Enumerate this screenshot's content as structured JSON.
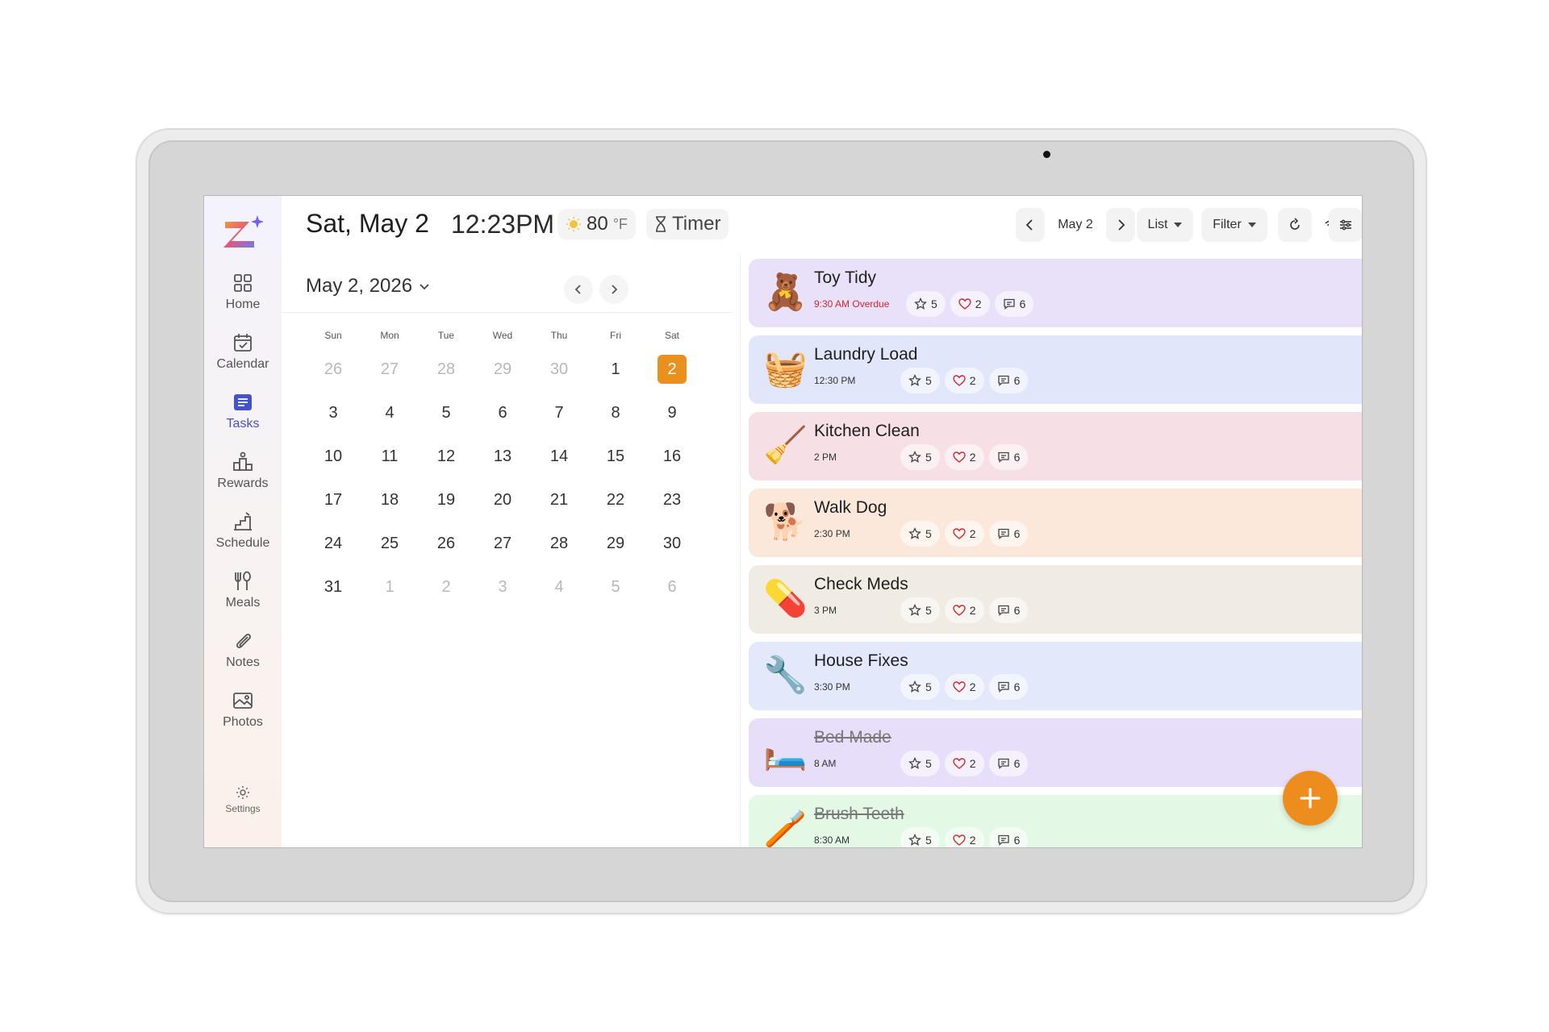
{
  "sidebar": {
    "items": [
      {
        "label": "Home",
        "icon": "home-grid-icon"
      },
      {
        "label": "Calendar",
        "icon": "calendar-check-icon"
      },
      {
        "label": "Tasks",
        "icon": "tasks-list-icon"
      },
      {
        "label": "Rewards",
        "icon": "rewards-podium-icon"
      },
      {
        "label": "Schedule",
        "icon": "schedule-stairs-icon"
      },
      {
        "label": "Meals",
        "icon": "meals-utensils-icon"
      },
      {
        "label": "Notes",
        "icon": "paperclip-icon"
      },
      {
        "label": "Photos",
        "icon": "photo-icon"
      }
    ],
    "active": "Tasks",
    "settings_label": "Settings"
  },
  "header": {
    "date": "Sat, May 2",
    "time": "12:23PM",
    "temperature": "80",
    "temperature_unit": "°F",
    "timer_label": "Timer",
    "current_day": "May 2",
    "view_label": "List",
    "filter_label": "Filter"
  },
  "calendar": {
    "title": "May 2, 2026",
    "weekdays": [
      "Sun",
      "Mon",
      "Tue",
      "Wed",
      "Thu",
      "Fri",
      "Sat"
    ],
    "weeks": [
      [
        "26",
        "27",
        "28",
        "29",
        "30",
        "1",
        "2"
      ],
      [
        "3",
        "4",
        "5",
        "6",
        "7",
        "8",
        "9"
      ],
      [
        "10",
        "11",
        "12",
        "13",
        "14",
        "15",
        "16"
      ],
      [
        "17",
        "18",
        "19",
        "20",
        "21",
        "22",
        "23"
      ],
      [
        "24",
        "25",
        "26",
        "27",
        "28",
        "29",
        "30"
      ],
      [
        "31",
        "1",
        "2",
        "3",
        "4",
        "5",
        "6"
      ]
    ],
    "selected": "2",
    "accent": "#eb8f1e"
  },
  "tasks": [
    {
      "name": "Toy Tidy",
      "time": "9:30 AM Overdue",
      "overdue": true,
      "stars": "5",
      "hearts": "2",
      "comments": "6",
      "emoji": "🧸",
      "bg": "#e9e1fa",
      "check_color": "#8a8a9a",
      "done": false
    },
    {
      "name": "Laundry Load",
      "time": "12:30 PM",
      "overdue": false,
      "stars": "5",
      "hearts": "2",
      "comments": "6",
      "emoji": "🧺",
      "bg": "#e1e6fa",
      "check_color": "#6f82c9",
      "done": false
    },
    {
      "name": "Kitchen Clean",
      "time": "2 PM",
      "overdue": false,
      "stars": "5",
      "hearts": "2",
      "comments": "6",
      "emoji": "🧹",
      "bg": "#f7dfe6",
      "check_color": "#d04a5c",
      "done": false
    },
    {
      "name": "Walk Dog",
      "time": "2:30 PM",
      "overdue": false,
      "stars": "5",
      "hearts": "2",
      "comments": "6",
      "emoji": "🐕",
      "bg": "#fce8da",
      "check_color": "#e8a04a",
      "done": false
    },
    {
      "name": "Check Meds",
      "time": "3 PM",
      "overdue": false,
      "stars": "5",
      "hearts": "2",
      "comments": "6",
      "emoji": "💊",
      "bg": "#f0ebe3",
      "check_color": "#b89b6a",
      "done": false
    },
    {
      "name": "House Fixes",
      "time": "3:30 PM",
      "overdue": false,
      "stars": "5",
      "hearts": "2",
      "comments": "6",
      "emoji": "🔧",
      "bg": "#e3e8fa",
      "check_color": "#7a8bc9",
      "done": false
    },
    {
      "name": "Bed Made",
      "time": "8 AM",
      "overdue": false,
      "stars": "5",
      "hearts": "2",
      "comments": "6",
      "emoji": "🛏️",
      "bg": "#e7dffa",
      "check_color": "#6a2fd6",
      "done": true
    },
    {
      "name": "Brush Teeth",
      "time": "8:30 AM",
      "overdue": false,
      "stars": "5",
      "hearts": "2",
      "comments": "6",
      "emoji": "🪥",
      "bg": "#e4f8e6",
      "check_color": "#6a2fd6",
      "done": true
    }
  ],
  "fab_color": "#ec8d1d"
}
